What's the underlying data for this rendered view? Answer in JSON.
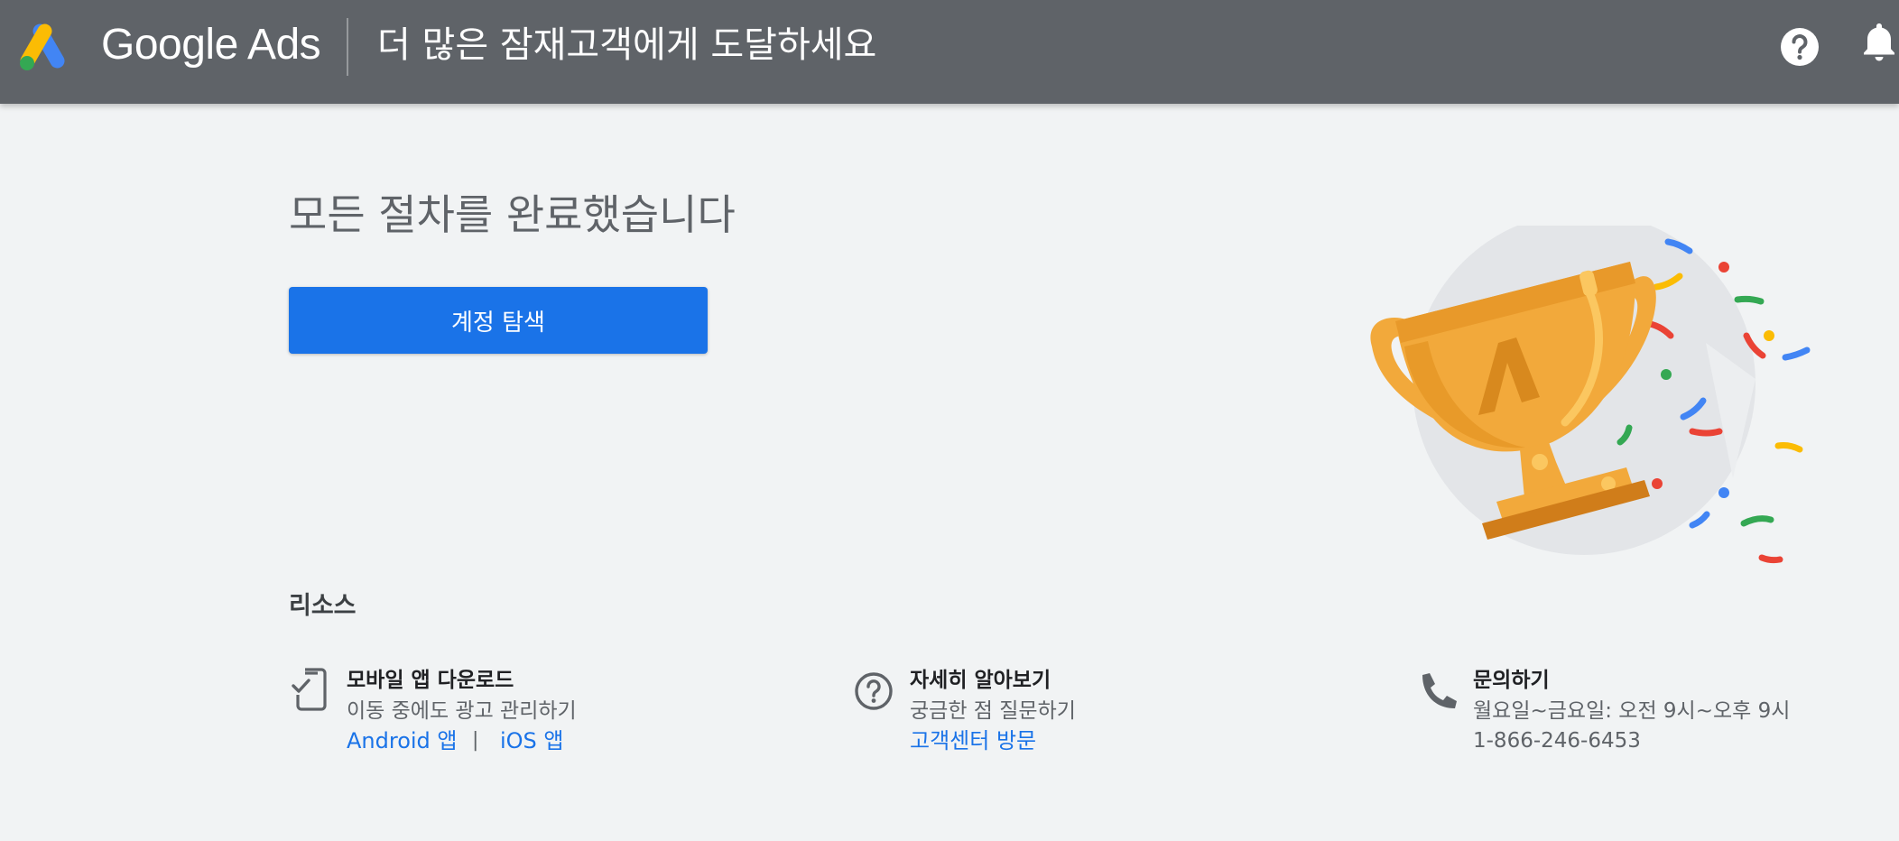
{
  "header": {
    "brand": "Google Ads",
    "title": "더 많은 잠재고객에게 도달하세요",
    "icons": [
      "google-ads-logo",
      "help-icon",
      "notification-bell-icon"
    ]
  },
  "main": {
    "title": "모든 절차를 완료했습니다",
    "explore_button": "계정 탐색",
    "illustration": "trophy-with-confetti"
  },
  "resources": {
    "title": "리소스",
    "items": [
      {
        "icon": "mobile-app-icon",
        "heading": "모바일 앱 다운로드",
        "text": "이동 중에도 광고 관리하기",
        "links": [
          "Android 앱",
          "iOS 앱"
        ],
        "separator": "|"
      },
      {
        "icon": "help-circle-icon",
        "heading": "자세히 알아보기",
        "text": "궁금한 점 질문하기",
        "links": [
          "고객센터 방문"
        ]
      },
      {
        "icon": "phone-icon",
        "heading": "문의하기",
        "text": "월요일~금요일: 오전 9시~오후 9시",
        "text2": "1-866-246-6453"
      }
    ]
  },
  "colors": {
    "header_bg": "#5f6368",
    "page_bg": "#f1f3f4",
    "primary": "#1a73e8",
    "trophy_gold": "#f2a93b"
  }
}
